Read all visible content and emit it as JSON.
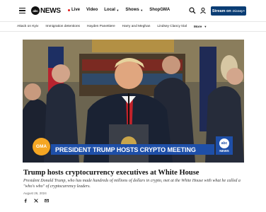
{
  "header": {
    "logo_ball": "abc",
    "logo_text": "NEWS",
    "nav": [
      {
        "label": "Live",
        "has_dot": true,
        "has_chevron": false
      },
      {
        "label": "Video",
        "has_dot": false,
        "has_chevron": false
      },
      {
        "label": "Local",
        "has_dot": false,
        "has_chevron": true
      },
      {
        "label": "Shows",
        "has_dot": false,
        "has_chevron": true
      },
      {
        "label": "ShopGMA",
        "has_dot": false,
        "has_chevron": false
      }
    ],
    "stream_button": {
      "label": "Stream on",
      "brand": "Disney+"
    },
    "colors": {
      "live_dot": "#e21b1b",
      "stream_button": "#0a3d74"
    }
  },
  "subnav": {
    "items": [
      "Attack on Kyiv",
      "Immigration detentions",
      "Hayden Panettiere",
      "Harry and Meghan",
      "Lindsey Clancy trial"
    ],
    "more_label": "More"
  },
  "video": {
    "bug_left": "GMA",
    "lower_third": "PRESIDENT TRUMP HOSTS CRYPTO MEETING",
    "bug_right_ball": "abc",
    "bug_right_text": "NEWS",
    "colors": {
      "lower_third": "#1e4fa8",
      "gma": "#f5a623"
    }
  },
  "article": {
    "headline": "Trump hosts cryptocurrency executives at White House",
    "deck": "President Donald Trump, who has made hundreds of millions of dollars in crypto, met at the White House with what he called a \"who's who\" of cryptocurrency leaders.",
    "date": "August 26, 2024",
    "share_icons": [
      "facebook-icon",
      "x-icon",
      "email-icon"
    ]
  }
}
